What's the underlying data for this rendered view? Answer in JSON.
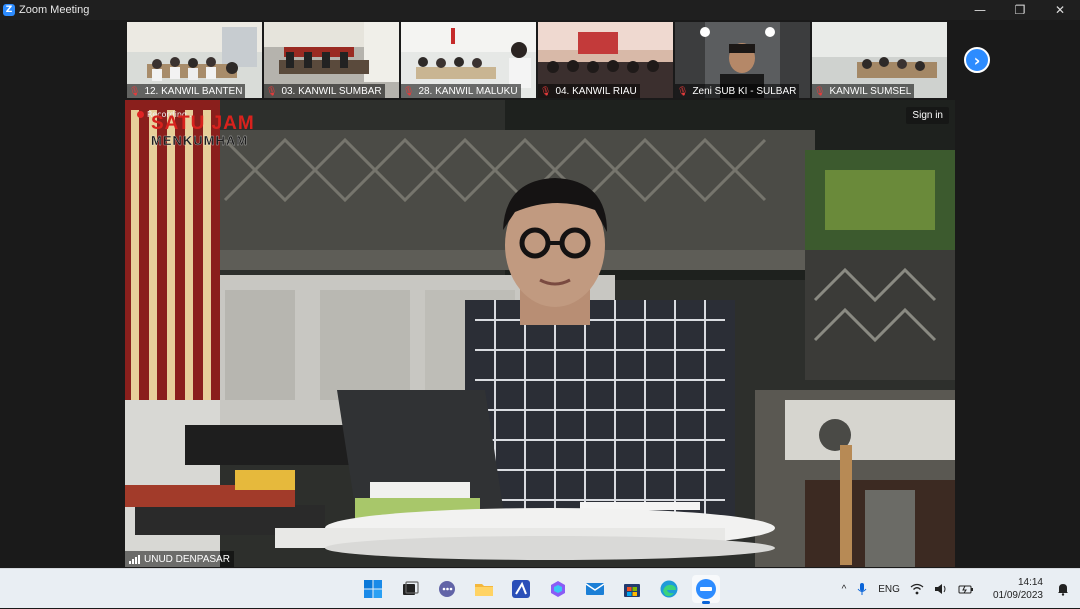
{
  "window": {
    "title": "Zoom Meeting",
    "app_icon_letter": "Z",
    "controls": {
      "minimize": "—",
      "restore": "❐",
      "close": "✕"
    }
  },
  "thumbnails": [
    {
      "label": "12. KANWIL BANTEN"
    },
    {
      "label": "03. KANWIL SUMBAR"
    },
    {
      "label": "28. KANWIL MALUKU"
    },
    {
      "label": "04. KANWIL RIAU"
    },
    {
      "label": "Zeni SUB KI - SULBAR"
    },
    {
      "label": "KANWIL SUMSEL"
    }
  ],
  "next_page_glyph": "›",
  "main_video": {
    "sign_in_label": "Sign in",
    "recording_label": "Recording...",
    "logo_line1": "SATU JAM",
    "logo_line2": "MENKUMHAM",
    "participant_name": "UNUD DENPASAR"
  },
  "taskbar": {
    "language": "ENG",
    "time": "14:14",
    "date": "01/09/2023",
    "tray_chevron": "^",
    "accent": "#0a64d8"
  },
  "colors": {
    "zoom_blue": "#2d8cff",
    "mic_muted": "#e63b3b",
    "recording_red": "#e02424"
  }
}
